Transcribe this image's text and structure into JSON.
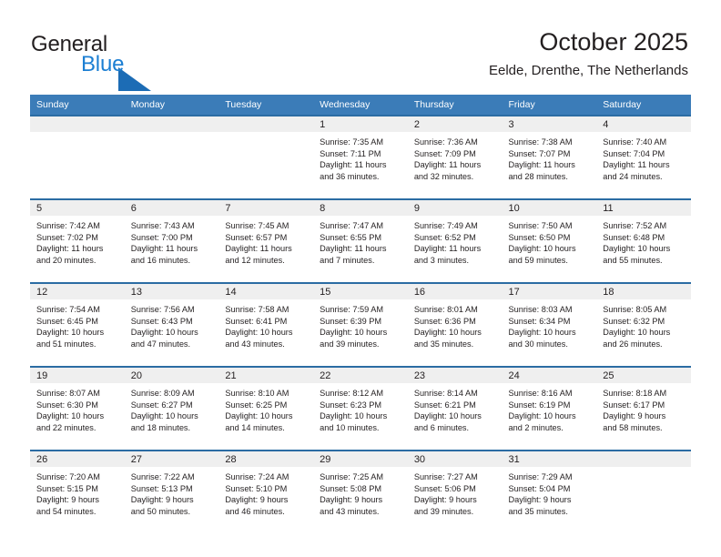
{
  "brand": {
    "name_part1": "General",
    "name_part2": "Blue",
    "logo_icon": "triangle-icon",
    "color_dark": "#231f20",
    "color_blue": "#1c7fd3"
  },
  "header": {
    "title": "October 2025",
    "subtitle": "Eelde, Drenthe, The Netherlands"
  },
  "theme": {
    "header_row_bg": "#3b7cb8",
    "row_rule": "#2b6ca3",
    "daynum_band_bg": "#efefef",
    "text": "#231f20"
  },
  "calendar": {
    "weekday_headers": [
      "Sunday",
      "Monday",
      "Tuesday",
      "Wednesday",
      "Thursday",
      "Friday",
      "Saturday"
    ],
    "weeks": [
      [
        {
          "day": "",
          "sunrise": "",
          "sunset": "",
          "daylight": "",
          "daylight2": ""
        },
        {
          "day": "",
          "sunrise": "",
          "sunset": "",
          "daylight": "",
          "daylight2": ""
        },
        {
          "day": "",
          "sunrise": "",
          "sunset": "",
          "daylight": "",
          "daylight2": ""
        },
        {
          "day": "1",
          "sunrise": "Sunrise: 7:35 AM",
          "sunset": "Sunset: 7:11 PM",
          "daylight": "Daylight: 11 hours",
          "daylight2": "and 36 minutes."
        },
        {
          "day": "2",
          "sunrise": "Sunrise: 7:36 AM",
          "sunset": "Sunset: 7:09 PM",
          "daylight": "Daylight: 11 hours",
          "daylight2": "and 32 minutes."
        },
        {
          "day": "3",
          "sunrise": "Sunrise: 7:38 AM",
          "sunset": "Sunset: 7:07 PM",
          "daylight": "Daylight: 11 hours",
          "daylight2": "and 28 minutes."
        },
        {
          "day": "4",
          "sunrise": "Sunrise: 7:40 AM",
          "sunset": "Sunset: 7:04 PM",
          "daylight": "Daylight: 11 hours",
          "daylight2": "and 24 minutes."
        }
      ],
      [
        {
          "day": "5",
          "sunrise": "Sunrise: 7:42 AM",
          "sunset": "Sunset: 7:02 PM",
          "daylight": "Daylight: 11 hours",
          "daylight2": "and 20 minutes."
        },
        {
          "day": "6",
          "sunrise": "Sunrise: 7:43 AM",
          "sunset": "Sunset: 7:00 PM",
          "daylight": "Daylight: 11 hours",
          "daylight2": "and 16 minutes."
        },
        {
          "day": "7",
          "sunrise": "Sunrise: 7:45 AM",
          "sunset": "Sunset: 6:57 PM",
          "daylight": "Daylight: 11 hours",
          "daylight2": "and 12 minutes."
        },
        {
          "day": "8",
          "sunrise": "Sunrise: 7:47 AM",
          "sunset": "Sunset: 6:55 PM",
          "daylight": "Daylight: 11 hours",
          "daylight2": "and 7 minutes."
        },
        {
          "day": "9",
          "sunrise": "Sunrise: 7:49 AM",
          "sunset": "Sunset: 6:52 PM",
          "daylight": "Daylight: 11 hours",
          "daylight2": "and 3 minutes."
        },
        {
          "day": "10",
          "sunrise": "Sunrise: 7:50 AM",
          "sunset": "Sunset: 6:50 PM",
          "daylight": "Daylight: 10 hours",
          "daylight2": "and 59 minutes."
        },
        {
          "day": "11",
          "sunrise": "Sunrise: 7:52 AM",
          "sunset": "Sunset: 6:48 PM",
          "daylight": "Daylight: 10 hours",
          "daylight2": "and 55 minutes."
        }
      ],
      [
        {
          "day": "12",
          "sunrise": "Sunrise: 7:54 AM",
          "sunset": "Sunset: 6:45 PM",
          "daylight": "Daylight: 10 hours",
          "daylight2": "and 51 minutes."
        },
        {
          "day": "13",
          "sunrise": "Sunrise: 7:56 AM",
          "sunset": "Sunset: 6:43 PM",
          "daylight": "Daylight: 10 hours",
          "daylight2": "and 47 minutes."
        },
        {
          "day": "14",
          "sunrise": "Sunrise: 7:58 AM",
          "sunset": "Sunset: 6:41 PM",
          "daylight": "Daylight: 10 hours",
          "daylight2": "and 43 minutes."
        },
        {
          "day": "15",
          "sunrise": "Sunrise: 7:59 AM",
          "sunset": "Sunset: 6:39 PM",
          "daylight": "Daylight: 10 hours",
          "daylight2": "and 39 minutes."
        },
        {
          "day": "16",
          "sunrise": "Sunrise: 8:01 AM",
          "sunset": "Sunset: 6:36 PM",
          "daylight": "Daylight: 10 hours",
          "daylight2": "and 35 minutes."
        },
        {
          "day": "17",
          "sunrise": "Sunrise: 8:03 AM",
          "sunset": "Sunset: 6:34 PM",
          "daylight": "Daylight: 10 hours",
          "daylight2": "and 30 minutes."
        },
        {
          "day": "18",
          "sunrise": "Sunrise: 8:05 AM",
          "sunset": "Sunset: 6:32 PM",
          "daylight": "Daylight: 10 hours",
          "daylight2": "and 26 minutes."
        }
      ],
      [
        {
          "day": "19",
          "sunrise": "Sunrise: 8:07 AM",
          "sunset": "Sunset: 6:30 PM",
          "daylight": "Daylight: 10 hours",
          "daylight2": "and 22 minutes."
        },
        {
          "day": "20",
          "sunrise": "Sunrise: 8:09 AM",
          "sunset": "Sunset: 6:27 PM",
          "daylight": "Daylight: 10 hours",
          "daylight2": "and 18 minutes."
        },
        {
          "day": "21",
          "sunrise": "Sunrise: 8:10 AM",
          "sunset": "Sunset: 6:25 PM",
          "daylight": "Daylight: 10 hours",
          "daylight2": "and 14 minutes."
        },
        {
          "day": "22",
          "sunrise": "Sunrise: 8:12 AM",
          "sunset": "Sunset: 6:23 PM",
          "daylight": "Daylight: 10 hours",
          "daylight2": "and 10 minutes."
        },
        {
          "day": "23",
          "sunrise": "Sunrise: 8:14 AM",
          "sunset": "Sunset: 6:21 PM",
          "daylight": "Daylight: 10 hours",
          "daylight2": "and 6 minutes."
        },
        {
          "day": "24",
          "sunrise": "Sunrise: 8:16 AM",
          "sunset": "Sunset: 6:19 PM",
          "daylight": "Daylight: 10 hours",
          "daylight2": "and 2 minutes."
        },
        {
          "day": "25",
          "sunrise": "Sunrise: 8:18 AM",
          "sunset": "Sunset: 6:17 PM",
          "daylight": "Daylight: 9 hours",
          "daylight2": "and 58 minutes."
        }
      ],
      [
        {
          "day": "26",
          "sunrise": "Sunrise: 7:20 AM",
          "sunset": "Sunset: 5:15 PM",
          "daylight": "Daylight: 9 hours",
          "daylight2": "and 54 minutes."
        },
        {
          "day": "27",
          "sunrise": "Sunrise: 7:22 AM",
          "sunset": "Sunset: 5:13 PM",
          "daylight": "Daylight: 9 hours",
          "daylight2": "and 50 minutes."
        },
        {
          "day": "28",
          "sunrise": "Sunrise: 7:24 AM",
          "sunset": "Sunset: 5:10 PM",
          "daylight": "Daylight: 9 hours",
          "daylight2": "and 46 minutes."
        },
        {
          "day": "29",
          "sunrise": "Sunrise: 7:25 AM",
          "sunset": "Sunset: 5:08 PM",
          "daylight": "Daylight: 9 hours",
          "daylight2": "and 43 minutes."
        },
        {
          "day": "30",
          "sunrise": "Sunrise: 7:27 AM",
          "sunset": "Sunset: 5:06 PM",
          "daylight": "Daylight: 9 hours",
          "daylight2": "and 39 minutes."
        },
        {
          "day": "31",
          "sunrise": "Sunrise: 7:29 AM",
          "sunset": "Sunset: 5:04 PM",
          "daylight": "Daylight: 9 hours",
          "daylight2": "and 35 minutes."
        },
        {
          "day": "",
          "sunrise": "",
          "sunset": "",
          "daylight": "",
          "daylight2": ""
        }
      ]
    ]
  }
}
